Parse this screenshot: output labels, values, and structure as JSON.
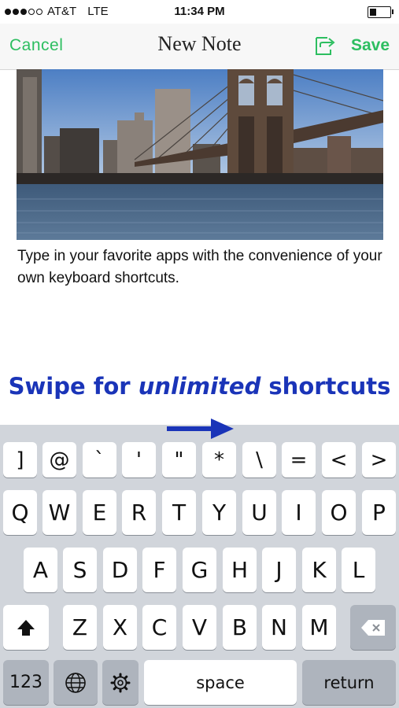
{
  "status": {
    "carrier": "AT&T",
    "network": "LTE",
    "time": "11:34 PM",
    "signal_bars_filled": 3,
    "signal_bars_total": 5,
    "battery_level": 0.35
  },
  "nav": {
    "cancel": "Cancel",
    "title": "New Note",
    "save": "Save",
    "share_icon": "share-icon"
  },
  "note": {
    "image_name": "bridge-photo",
    "text": "Type in your favorite apps with the convenience of your own keyboard shortcuts."
  },
  "promo": {
    "prefix": "Swipe for ",
    "emphasis": "unlimited",
    "suffix": " shortcuts"
  },
  "keyboard": {
    "symbols": [
      "]",
      "@",
      "`",
      "'",
      "\"",
      "*",
      "\\",
      "=",
      "<",
      ">"
    ],
    "row1": [
      "Q",
      "W",
      "E",
      "R",
      "T",
      "Y",
      "U",
      "I",
      "O",
      "P"
    ],
    "row2": [
      "A",
      "S",
      "D",
      "F",
      "G",
      "H",
      "J",
      "K",
      "L"
    ],
    "row3": [
      "Z",
      "X",
      "C",
      "V",
      "B",
      "N",
      "M"
    ],
    "numbers": "123",
    "space": "space",
    "return": "return",
    "accent": "#2dbe60",
    "promo_color": "#1a34b8"
  }
}
